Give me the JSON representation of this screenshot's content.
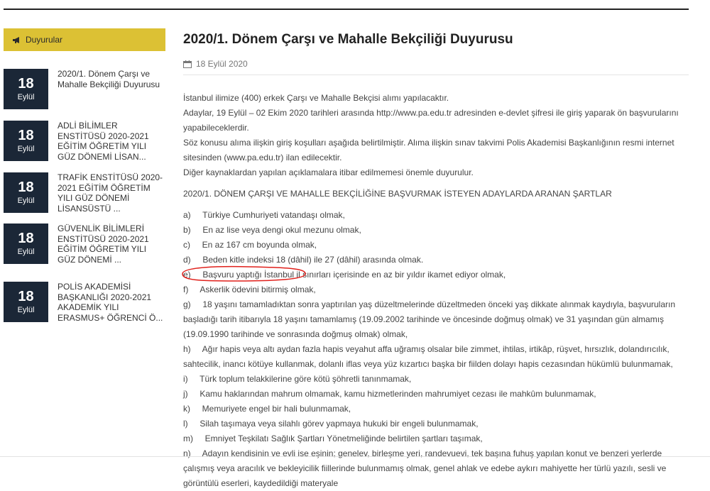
{
  "sidebar": {
    "header_label": "Duyurular",
    "items": [
      {
        "day": "18",
        "month": "Eylül",
        "title": "2020/1. Dönem Çarşı ve Mahalle Bekçiliği Duyurusu"
      },
      {
        "day": "18",
        "month": "Eylül",
        "title": "ADLİ BİLİMLER ENSTİTÜSÜ 2020-2021 EĞİTİM ÖĞRETİM YILI GÜZ DÖNEMİ LİSAN..."
      },
      {
        "day": "18",
        "month": "Eylül",
        "title": "TRAFİK ENSTİTÜSÜ 2020-2021 EĞİTİM ÖĞRETİM YILI GÜZ DÖNEMİ LİSANSÜSTÜ ..."
      },
      {
        "day": "18",
        "month": "Eylül",
        "title": "GÜVENLİK BİLİMLERİ ENSTİTÜSÜ 2020-2021 EĞİTİM ÖĞRETİM YILI GÜZ DÖNEMİ ..."
      },
      {
        "day": "18",
        "month": "Eylül",
        "title": "POLİS AKADEMİSİ BAŞKANLIĞI 2020-2021 AKADEMİK YILI ERASMUS+ ÖĞRENCİ Ö..."
      }
    ]
  },
  "article": {
    "title": "2020/1. Dönem Çarşı ve Mahalle Bekçiliği Duyurusu",
    "date": "18 Eylül 2020",
    "intro": [
      "İstanbul ilimize (400) erkek Çarşı ve Mahalle Bekçisi alımı yapılacaktır.",
      "Adaylar, 19 Eylül – 02 Ekim 2020 tarihleri arasında http://www.pa.edu.tr adresinden e-devlet şifresi ile giriş yaparak ön başvurularını yapabileceklerdir.",
      "Söz konusu alıma ilişkin giriş koşulları aşağıda belirtilmiştir. Alıma ilişkin sınav takvimi Polis Akademisi Başkanlığının resmi internet sitesinden (www.pa.edu.tr) ilan edilecektir.",
      "Diğer kaynaklardan yapılan açıklamalara itibar edilmemesi önemle duyurulur."
    ],
    "section_heading": "2020/1. DÖNEM ÇARŞI VE MAHALLE BEKÇİLİĞİNE BAŞVURMAK İSTEYEN ADAYLARDA ARANAN ŞARTLAR",
    "conditions": [
      "a)     Türkiye Cumhuriyeti vatandaşı olmak,",
      "b)     En az lise veya dengi okul mezunu olmak,",
      "c)     En az 167 cm boyunda olmak,",
      "d)     Beden kitle indeksi 18 (dâhil) ile 27 (dâhil) arasında olmak.",
      "e)     Başvuru yaptığı İstanbul il sınırları içerisinde en az bir yıldır ikamet ediyor olmak,",
      "f)     Askerlik ödevini bitirmiş olmak,",
      "g)     18 yaşını tamamladıktan sonra yaptırılan yaş düzeltmelerinde düzeltmeden önceki yaş dikkate alınmak kaydıyla, başvuruların başladığı tarih itibarıyla 18 yaşını tamamlamış (19.09.2002 tarihinde ve öncesinde doğmuş olmak) ve 31 yaşından gün almamış (19.09.1990 tarihinde ve sonrasında doğmuş olmak) olmak,",
      "h)     Ağır hapis veya altı aydan fazla hapis veyahut affa uğramış olsalar bile zimmet, ihtilas, irtikâp, rüşvet, hırsızlık, dolandırıcılık, sahtecilik, inancı kötüye kullanmak, dolanlı iflas veya yüz kızartıcı başka bir fiilden dolayı hapis cezasından hükümlü bulunmamak,",
      "i)     Türk toplum telakkilerine göre kötü şöhretli tanınmamak,",
      "j)     Kamu haklarından mahrum olmamak, kamu hizmetlerinden mahrumiyet cezası ile mahkûm bulunmamak,",
      "k)     Memuriyete engel bir hali bulunmamak,",
      "l)     Silah taşımaya veya silahlı görev yapmaya hukuki bir engeli bulunmamak,",
      "m)     Emniyet Teşkilatı Sağlık Şartları Yönetmeliğinde belirtilen şartları taşımak,",
      "n)     Adayın kendisinin ve evli ise eşinin; genelev, birleşme yeri, randevuevi, tek başına fuhuş yapılan konut ve benzeri yerlerde çalışmış veya aracılık ve bekleyicilik fiillerinde bulunmamış olmak, genel ahlak ve edebe aykırı mahiyette her türlü yazılı, sesli ve görüntülü eserleri, kaydedildiği materyale"
    ]
  },
  "colors": {
    "accent": "#dcc134",
    "date_box": "#1b2737",
    "annotation": "#e0201b"
  }
}
